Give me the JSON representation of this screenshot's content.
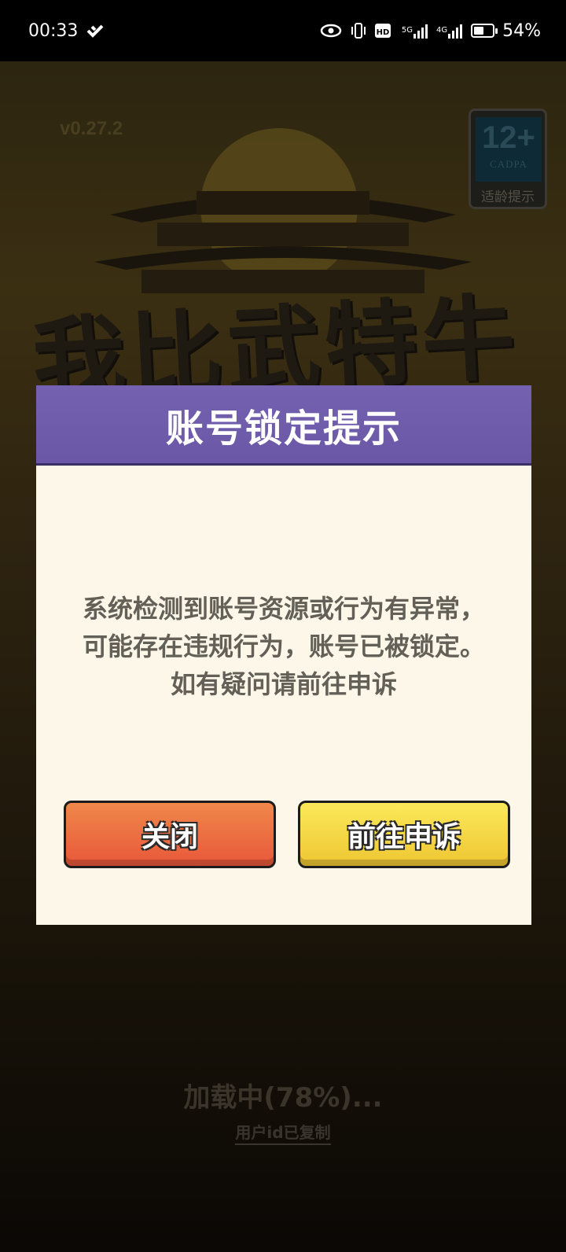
{
  "status_bar": {
    "time": "00:33",
    "net_5g": "5G",
    "net_4g": "4G",
    "hd_label": "HD",
    "battery_percent": "54%",
    "battery_level": 0.54
  },
  "game": {
    "version": "v0.27.2",
    "age_rating": {
      "number": "12+",
      "org": "CADPA",
      "label": "适龄提示"
    },
    "title_art": "我比武特牛",
    "loading_text": "加载中(78%)...",
    "loading_progress": 0.78,
    "copied_link": "用户id已复制"
  },
  "dialog": {
    "title": "账号锁定提示",
    "message": "系统检测到账号资源或行为有异常，可能存在违规行为，账号已被锁定。如有疑问请前往申诉",
    "close_label": "关闭",
    "appeal_label": "前往申诉"
  },
  "colors": {
    "header": "#6a58a6",
    "body": "#fcf7e9",
    "close_button": "#e8573a",
    "appeal_button": "#eec632"
  }
}
